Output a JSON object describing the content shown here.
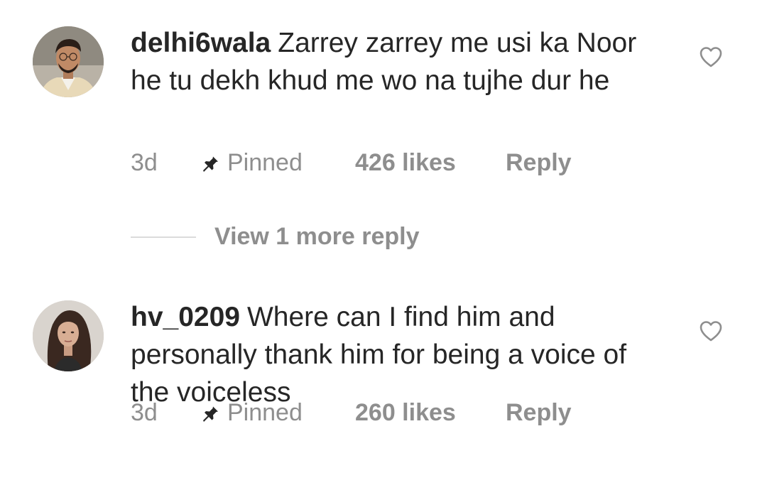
{
  "comments": [
    {
      "username": "delhi6wala",
      "text": "Zarrey zarrey me usi ka Noor he tu dekh khud me wo na tujhe dur he",
      "time": "3d",
      "pinned_label": "Pinned",
      "likes": "426 likes",
      "reply_label": "Reply",
      "avatar_icon": "man-portrait-avatar",
      "like_icon": "heart-outline-icon"
    },
    {
      "username": "hv_0209",
      "text": "Where can I find him and personally thank him for being a voice of the voiceless",
      "time": "3d",
      "pinned_label": "Pinned",
      "likes": "260 likes",
      "reply_label": "Reply",
      "avatar_icon": "woman-portrait-avatar",
      "like_icon": "heart-outline-icon"
    }
  ],
  "view_replies": {
    "label": "View 1 more reply"
  },
  "colors": {
    "text_primary": "#262626",
    "text_secondary": "#8e8e8e",
    "divider": "#dbdbdb",
    "background": "#ffffff"
  }
}
